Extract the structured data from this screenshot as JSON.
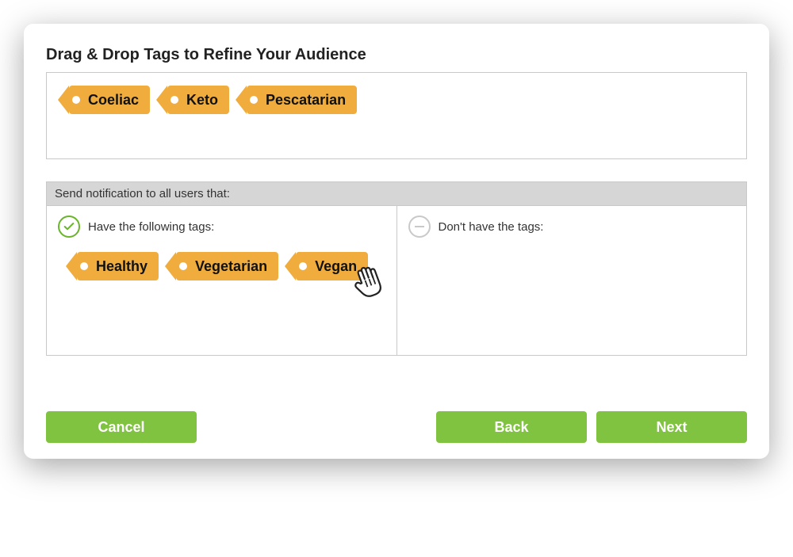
{
  "title": "Drag & Drop Tags to Refine Your Audience",
  "available_tags": [
    "Coeliac",
    "Keto",
    "Pescatarian"
  ],
  "rule_header": "Send notification to all users that:",
  "include": {
    "label": "Have the following tags:",
    "tags": [
      "Healthy",
      "Vegetarian",
      "Vegan"
    ]
  },
  "exclude": {
    "label": "Don't have the tags:",
    "tags": []
  },
  "buttons": {
    "cancel": "Cancel",
    "back": "Back",
    "next": "Next"
  }
}
